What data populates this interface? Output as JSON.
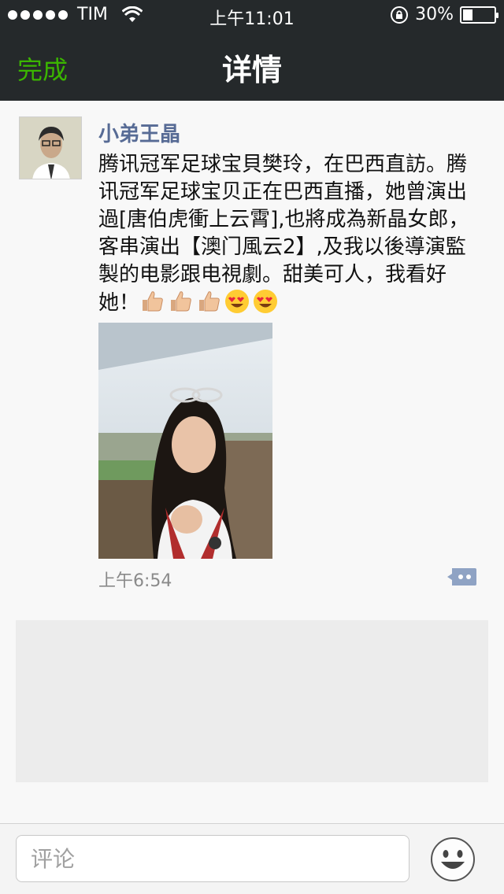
{
  "status_bar": {
    "carrier": "TIM",
    "time": "上午11:01",
    "battery_text": "30%",
    "battery_level": 0.3
  },
  "nav": {
    "back_label": "完成",
    "title": "详情"
  },
  "post": {
    "author": "小弟王晶",
    "text": "腾讯冠军足球宝貝樊玲，在巴西直訪。腾讯冠军足球宝贝正在巴西直播，她曾演出過[唐伯虎衝上云霄],也將成為新晶女郎，客串演出【澳门風云2】,及我以後導演監製的电影跟电視劇。甜美可人，我看好她！",
    "emoji": [
      "thumbs-up-icon",
      "thumbs-up-icon",
      "thumbs-up-icon",
      "heart-eyes-icon",
      "heart-eyes-icon"
    ],
    "time": "上午6:54"
  },
  "comment_bar": {
    "placeholder": "评论"
  },
  "colors": {
    "nav_bg": "#25292b",
    "accent_green": "#3bb500",
    "author_blue": "#576b95"
  }
}
